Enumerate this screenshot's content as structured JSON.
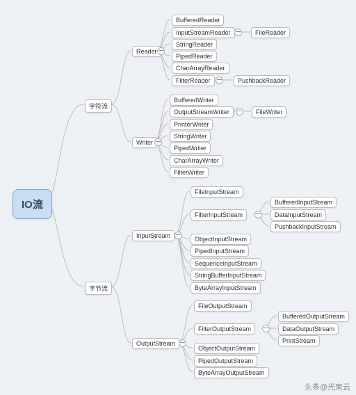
{
  "root": "IO流",
  "groups": {
    "char": "字符流",
    "byte": "字节流",
    "reader": "Reader",
    "writer": "Writer",
    "inputStream": "InputStream",
    "outputStream": "OutputStream"
  },
  "reader": {
    "bufferedReader": "BufferedReader",
    "inputStreamReader": "InputStreamReader",
    "fileReader": "FileReader",
    "stringReader": "StringReader",
    "pipedReader": "PipedReader",
    "charArrayReader": "CharArrayReader",
    "filterReader": "FilterReader",
    "pushbackReader": "PushbackReader"
  },
  "writer": {
    "bufferedWriter": "BufferedWriter",
    "outputStreamWriter": "OutputStreamWriter",
    "fileWriter": "FileWriter",
    "printerWriter": "PrinterWriter",
    "stringWriter": "StringWriter",
    "pipedWriter": "PipedWriter",
    "charArrayWriter": "CharArrayWriter",
    "filterWriter": "FilterWriter"
  },
  "in": {
    "fileInputStream": "FileInputStream",
    "filterInputStream": "FilterInputStream",
    "bufferedInputStream": "BufferedInputStream",
    "dataInputStream": "DataInputStream",
    "pushbackInputStream": "PushbackInputStream",
    "objectInputStream": "ObjectInputStream",
    "pipedInputStream": "PipedInputStream",
    "sequenceInputStream": "SequenceInputStream",
    "stringBufferInputStream": "StringBufferInputStream",
    "byteArrayInputStream": "ByteArrayInputStream"
  },
  "out": {
    "fileOutputStream": "FileOutputStream",
    "filterOutputStream": "FilterOutputStream",
    "bufferedOutputStream": "BufferedOutputStream",
    "dataOutputStream": "DataOutputStream",
    "printStream": "PrintStream",
    "objectOutputStream": "ObjectOutputStream",
    "pipedOutputStream": "PipedOutputStream",
    "byteArrayOutputStream": "ByteArrayOutputStream"
  },
  "watermark": "头条@光束云"
}
